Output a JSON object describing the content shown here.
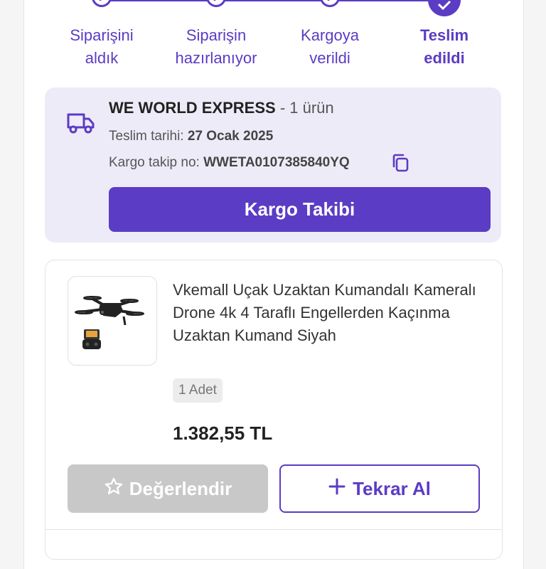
{
  "stepper": {
    "steps": [
      {
        "label_line1": "Siparişini",
        "label_line2": "aldık",
        "state": "done"
      },
      {
        "label_line1": "Siparişin",
        "label_line2": "hazırlanıyor",
        "state": "done"
      },
      {
        "label_line1": "Kargoya",
        "label_line2": "verildi",
        "state": "done"
      },
      {
        "label_line1": "Teslim",
        "label_line2": "edildi",
        "state": "current"
      }
    ],
    "accent": "#5b3cc4"
  },
  "shipment": {
    "carrier": "WE WORLD EXPRESS",
    "item_count": "- 1 ürün",
    "delivery_label": "Teslim tarihi:",
    "delivery_date": "27 Ocak 2025",
    "tracking_label": "Kargo takip no:",
    "tracking_no": "WWETA0107385840YQ",
    "track_button": "Kargo Takibi",
    "truck_icon": "truck-icon",
    "copy_icon": "copy-icon"
  },
  "product": {
    "title": "Vkemall Uçak Uzaktan Kumandalı Kameralı Drone 4k 4 Taraflı Engellerden Kaçınma Uzaktan Kumand Siyah",
    "quantity": "1 Adet",
    "price": "1.382,55 TL",
    "rate_button": "Değerlendir",
    "rate_icon": "star-icon",
    "rebuy_button": "Tekrar Al",
    "rebuy_icon": "plus-icon"
  }
}
